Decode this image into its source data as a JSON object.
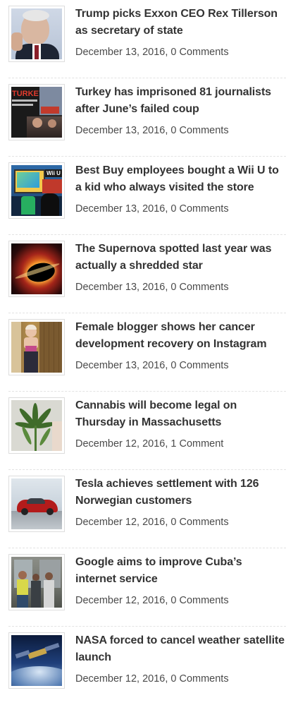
{
  "articles": [
    {
      "title": "Trump picks Exxon CEO Rex Tillerson as secretary of state",
      "date": "December 13, 2016",
      "comments": "0 Comments",
      "thumb": "portrait"
    },
    {
      "title": "Turkey has imprisoned 81 journalists after June’s failed coup",
      "date": "December 13, 2016",
      "comments": "0 Comments",
      "thumb": "protest",
      "thumb_text": "TURKEY"
    },
    {
      "title": "Best Buy employees bought a Wii U to a kid who always visited the store",
      "date": "December 13, 2016",
      "comments": "0 Comments",
      "thumb": "store",
      "thumb_text": "Wii U"
    },
    {
      "title": "The Supernova spotted last year was actually a shredded star",
      "date": "December 13, 2016",
      "comments": "0 Comments",
      "thumb": "blackhole"
    },
    {
      "title": "Female blogger shows her cancer development recovery on Instagram",
      "date": "December 13, 2016",
      "comments": "0 Comments",
      "thumb": "gym"
    },
    {
      "title": "Cannabis will become legal on Thursday in Massachusetts",
      "date": "December 12, 2016",
      "comments": "1 Comment",
      "thumb": "plant"
    },
    {
      "title": "Tesla achieves settlement with 126 Norwegian customers",
      "date": "December 12, 2016",
      "comments": "0 Comments",
      "thumb": "car"
    },
    {
      "title": "Google aims to improve Cuba’s internet service",
      "date": "December 12, 2016",
      "comments": "0 Comments",
      "thumb": "street"
    },
    {
      "title": "NASA forced to cancel weather satellite launch",
      "date": "December 12, 2016",
      "comments": "0 Comments",
      "thumb": "satellite"
    }
  ],
  "separator": ","
}
